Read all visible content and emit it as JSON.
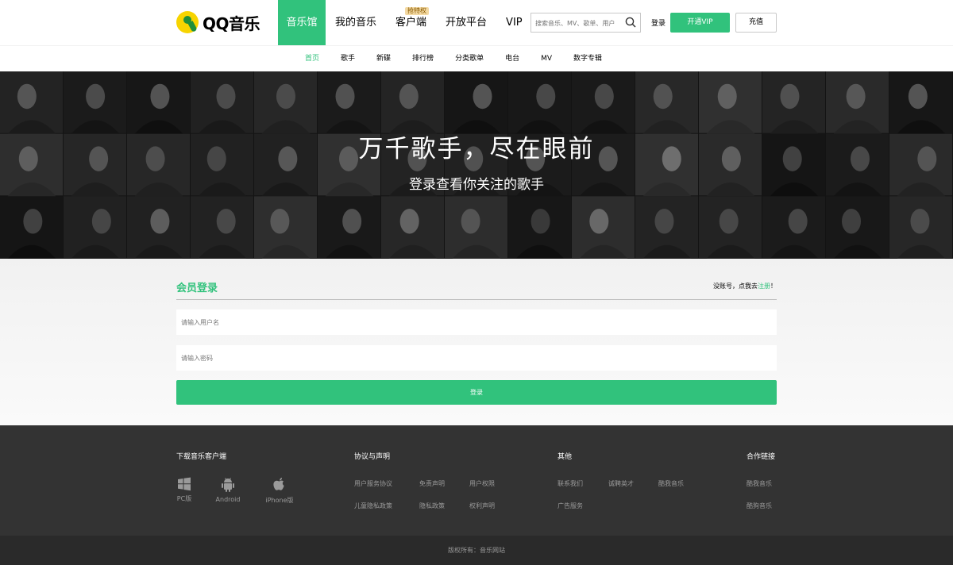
{
  "brand": {
    "logo_text": "QQ音乐",
    "accent": "#31c27c"
  },
  "header": {
    "nav": [
      {
        "label": "音乐馆",
        "active": true
      },
      {
        "label": "我的音乐"
      },
      {
        "label": "客户端",
        "badge": "抢特权"
      },
      {
        "label": "开放平台"
      },
      {
        "label": "VIP"
      }
    ],
    "search_placeholder": "搜索音乐、MV、歌单、用户",
    "login": "登录",
    "vip_button": "开通VIP",
    "recharge_button": "充值"
  },
  "subnav": [
    "首页",
    "歌手",
    "新碟",
    "排行榜",
    "分类歌单",
    "电台",
    "MV",
    "数字专辑"
  ],
  "banner": {
    "title": "万千歌手，尽在眼前",
    "subtitle": "登录查看你关注的歌手"
  },
  "login_form": {
    "title": "会员登录",
    "register_prefix": "没账号，点我去",
    "register_link": "注册",
    "register_suffix": "！",
    "username_placeholder": "请输入用户名",
    "password_placeholder": "请输入密码",
    "submit": "登录"
  },
  "footer": {
    "download_title": "下载音乐客户端",
    "downloads": [
      {
        "label": "PC版",
        "icon": "windows-icon"
      },
      {
        "label": "Android",
        "icon": "android-icon"
      },
      {
        "label": "iPhone版",
        "icon": "apple-icon"
      }
    ],
    "agreement_title": "协议与声明",
    "agreement_links": [
      "用户服务协议",
      "免责声明",
      "用户权限",
      "儿童隐私政策",
      "隐私政策",
      "权利声明"
    ],
    "other_title": "其他",
    "other_links": [
      "联系我们",
      "诚聘英才",
      "酷我音乐",
      "广告服务"
    ],
    "partner_title": "合作链接",
    "partner_links": [
      "酷我音乐",
      "酷狗音乐"
    ],
    "copyright": "版权所有：音乐网站"
  }
}
